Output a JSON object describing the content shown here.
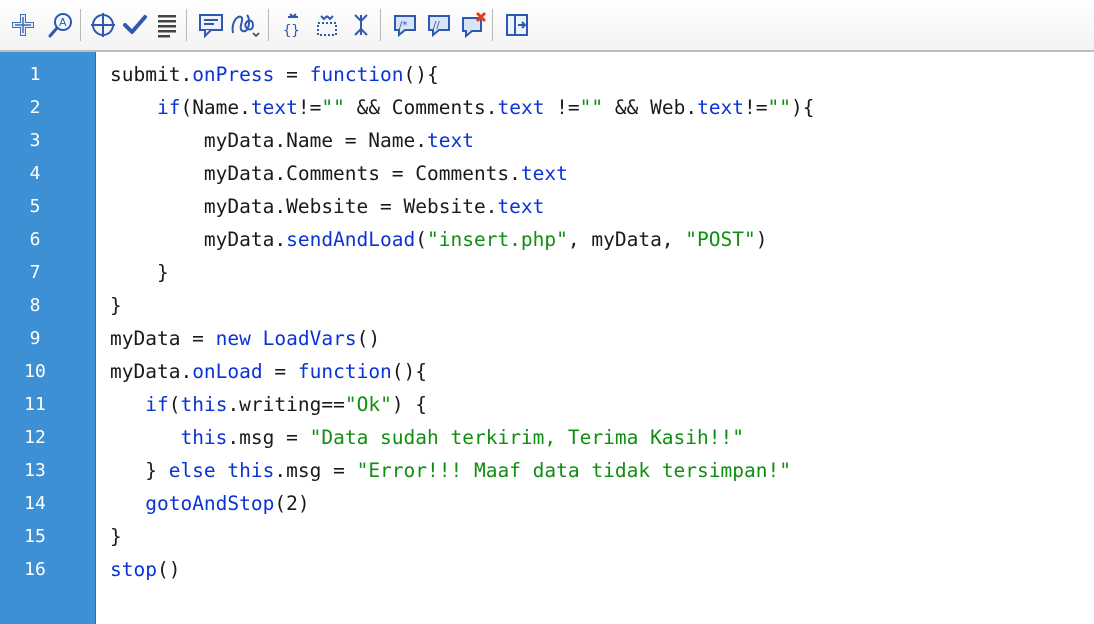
{
  "toolbar": {
    "buttons": [
      {
        "name": "add-statement-icon",
        "tip": "Add a new item to the script"
      },
      {
        "name": "find-icon",
        "tip": "Find"
      },
      {
        "name": "insert-target-path-icon",
        "tip": "Insert a target path"
      },
      {
        "name": "check-syntax-icon",
        "tip": "Check syntax"
      },
      {
        "name": "auto-format-icon",
        "tip": "Auto format"
      },
      {
        "name": "show-code-hint-icon",
        "tip": "Show code hint"
      },
      {
        "name": "debug-options-icon",
        "tip": "Debug options"
      },
      {
        "name": "collapse-braces-icon",
        "tip": "Collapse between braces"
      },
      {
        "name": "collapse-selection-icon",
        "tip": "Collapse selection"
      },
      {
        "name": "expand-all-icon",
        "tip": "Expand all"
      },
      {
        "name": "apply-block-comment-icon",
        "tip": "Apply block comment"
      },
      {
        "name": "apply-line-comment-icon",
        "tip": "Apply line comment"
      },
      {
        "name": "remove-comment-icon",
        "tip": "Remove comment"
      },
      {
        "name": "show-hide-toolbox-icon",
        "tip": "Show/Hide toolbox"
      }
    ]
  },
  "colors": {
    "keyword": "#0a33d6",
    "string": "#0f8f0f",
    "plain": "#1a1a1a",
    "gutter": "#3d90d3"
  },
  "editor": {
    "lines": [
      {
        "num": "1",
        "tokens": [
          [
            "pl",
            "submit."
          ],
          [
            "kw",
            "onPress"
          ],
          [
            "pl",
            " = "
          ],
          [
            "kw",
            "function"
          ],
          [
            "pl",
            "(){"
          ]
        ]
      },
      {
        "num": "2",
        "tokens": [
          [
            "pl",
            "    "
          ],
          [
            "kw",
            "if"
          ],
          [
            "pl",
            "(Name."
          ],
          [
            "kw",
            "text"
          ],
          [
            "pl",
            "!="
          ],
          [
            "str",
            "\"\""
          ],
          [
            "pl",
            " && Comments."
          ],
          [
            "kw",
            "text"
          ],
          [
            "pl",
            " !="
          ],
          [
            "str",
            "\"\""
          ],
          [
            "pl",
            " && Web."
          ],
          [
            "kw",
            "text"
          ],
          [
            "pl",
            "!="
          ],
          [
            "str",
            "\"\""
          ],
          [
            "pl",
            "){"
          ]
        ]
      },
      {
        "num": "3",
        "tokens": [
          [
            "pl",
            "        myData.Name = Name."
          ],
          [
            "kw",
            "text"
          ]
        ]
      },
      {
        "num": "4",
        "tokens": [
          [
            "pl",
            "        myData.Comments = Comments."
          ],
          [
            "kw",
            "text"
          ]
        ]
      },
      {
        "num": "5",
        "tokens": [
          [
            "pl",
            "        myData.Website = Website."
          ],
          [
            "kw",
            "text"
          ]
        ]
      },
      {
        "num": "6",
        "tokens": [
          [
            "pl",
            "        myData."
          ],
          [
            "kw",
            "sendAndLoad"
          ],
          [
            "pl",
            "("
          ],
          [
            "str",
            "\"insert.php\""
          ],
          [
            "pl",
            ", myData, "
          ],
          [
            "str",
            "\"POST\""
          ],
          [
            "pl",
            ")"
          ]
        ]
      },
      {
        "num": "7",
        "tokens": [
          [
            "pl",
            "    }"
          ]
        ]
      },
      {
        "num": "8",
        "tokens": [
          [
            "pl",
            "}"
          ]
        ]
      },
      {
        "num": "9",
        "tokens": [
          [
            "pl",
            "myData = "
          ],
          [
            "kw",
            "new"
          ],
          [
            "pl",
            " "
          ],
          [
            "kw",
            "LoadVars"
          ],
          [
            "pl",
            "()"
          ]
        ]
      },
      {
        "num": "10",
        "tokens": [
          [
            "pl",
            "myData."
          ],
          [
            "kw",
            "onLoad"
          ],
          [
            "pl",
            " = "
          ],
          [
            "kw",
            "function"
          ],
          [
            "pl",
            "(){"
          ]
        ]
      },
      {
        "num": "11",
        "tokens": [
          [
            "pl",
            "   "
          ],
          [
            "kw",
            "if"
          ],
          [
            "pl",
            "("
          ],
          [
            "kw",
            "this"
          ],
          [
            "pl",
            ".writing=="
          ],
          [
            "str",
            "\"Ok\""
          ],
          [
            "pl",
            ") {"
          ]
        ]
      },
      {
        "num": "12",
        "tokens": [
          [
            "pl",
            "      "
          ],
          [
            "kw",
            "this"
          ],
          [
            "pl",
            ".msg = "
          ],
          [
            "str",
            "\"Data sudah terkirim, Terima Kasih!!\""
          ]
        ]
      },
      {
        "num": "13",
        "tokens": [
          [
            "pl",
            "   } "
          ],
          [
            "kw",
            "else"
          ],
          [
            "pl",
            " "
          ],
          [
            "kw",
            "this"
          ],
          [
            "pl",
            ".msg = "
          ],
          [
            "str",
            "\"Error!!! Maaf data tidak tersimpan!\""
          ]
        ]
      },
      {
        "num": "14",
        "tokens": [
          [
            "pl",
            "   "
          ],
          [
            "kw",
            "gotoAndStop"
          ],
          [
            "pl",
            "(2)"
          ]
        ]
      },
      {
        "num": "15",
        "tokens": [
          [
            "pl",
            "}"
          ]
        ]
      },
      {
        "num": "16",
        "tokens": [
          [
            "kw",
            "stop"
          ],
          [
            "pl",
            "()"
          ]
        ]
      }
    ]
  }
}
